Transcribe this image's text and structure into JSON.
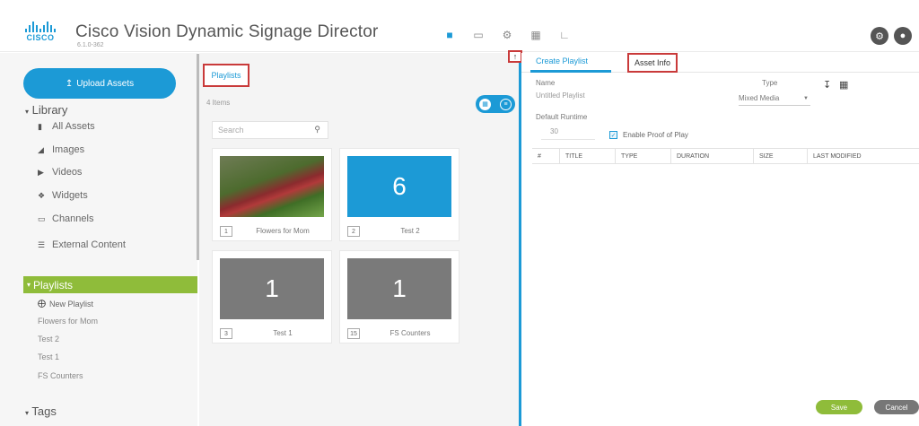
{
  "header": {
    "logo_text": "CISCO",
    "title": "Cisco Vision Dynamic Signage Director",
    "version": "6.1.0-362",
    "nav_icons": [
      "folder-icon",
      "display-icon",
      "gear-icon",
      "grid-icon",
      "chart-icon"
    ],
    "right_icons": [
      "settings-icon",
      "user-icon"
    ]
  },
  "sidebar": {
    "upload_label": "Upload Assets",
    "library_label": "Library",
    "library_items": [
      {
        "label": "All Assets",
        "icon": "file-icon"
      },
      {
        "label": "Images",
        "icon": "image-icon"
      },
      {
        "label": "Videos",
        "icon": "video-icon"
      },
      {
        "label": "Widgets",
        "icon": "widget-icon"
      },
      {
        "label": "Channels",
        "icon": "channel-icon"
      },
      {
        "label": "External Content",
        "icon": "external-icon"
      }
    ],
    "playlists_label": "Playlists",
    "playlist_items": [
      "New Playlist",
      "Flowers for Mom",
      "Test 2",
      "Test 1",
      "FS Counters"
    ],
    "tags_label": "Tags"
  },
  "middle": {
    "title": "Playlists",
    "items_count": "4 Items",
    "search_placeholder": "Search",
    "cards": [
      {
        "index": "1",
        "name": "Flowers for Mom",
        "thumb_type": "photo",
        "thumb_text": ""
      },
      {
        "index": "2",
        "name": "Test 2",
        "thumb_type": "blue",
        "thumb_text": "6"
      },
      {
        "index": "3",
        "name": "Test 1",
        "thumb_type": "gray",
        "thumb_text": "1"
      },
      {
        "index": "15",
        "name": "FS Counters",
        "thumb_type": "gray",
        "thumb_text": "1"
      }
    ]
  },
  "right": {
    "tab_create": "Create Playlist",
    "tab_asset_info": "Asset Info",
    "name_label": "Name",
    "name_placeholder": "Untitled Playlist",
    "type_label": "Type",
    "type_value": "Mixed Media",
    "runtime_label": "Default Runtime",
    "runtime_value": "30",
    "proof_label": "Enable Proof of Play",
    "columns": [
      "#",
      "TITLE",
      "TYPE",
      "DURATION",
      "SIZE",
      "LAST MODIFIED"
    ],
    "save_label": "Save",
    "cancel_label": "Cancel"
  },
  "colors": {
    "accent": "#1c9ad6",
    "playlists_active": "#8fbc3a",
    "highlight_box": "#c93a3a"
  }
}
